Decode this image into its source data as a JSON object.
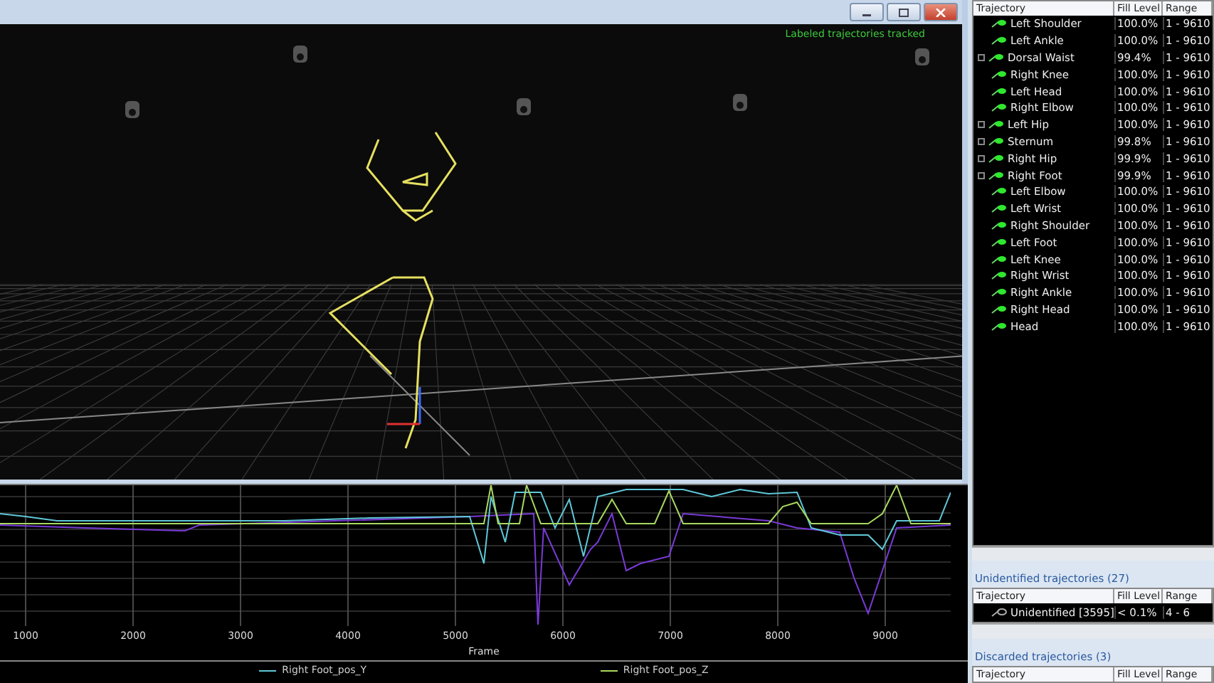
{
  "viewport": {
    "status": "Labeled trajectories tracked"
  },
  "window_buttons": [
    {
      "kind": "minimize"
    },
    {
      "kind": "maximize"
    },
    {
      "kind": "close"
    }
  ],
  "graph": {
    "x_tick_labels": [
      "1000",
      "2000",
      "3000",
      "4000",
      "5000",
      "6000",
      "7000",
      "8000",
      "9000"
    ],
    "xlabel": "Frame",
    "legend": [
      {
        "name": "Right Foot_pos_Y",
        "color": "#5fc8d8"
      },
      {
        "name": "Right Foot_pos_Z",
        "color": "#a8d860"
      }
    ]
  },
  "labeled": {
    "columns": [
      "Trajectory",
      "Fill Level",
      "Range"
    ],
    "rows": [
      {
        "name": "Left Shoulder",
        "fill": "100.0%",
        "range": "1 - 9610",
        "expandable": false
      },
      {
        "name": "Left Ankle",
        "fill": "100.0%",
        "range": "1 - 9610",
        "expandable": false
      },
      {
        "name": "Dorsal Waist",
        "fill": "99.4%",
        "range": "1 - 9610",
        "expandable": true
      },
      {
        "name": "Right Knee",
        "fill": "100.0%",
        "range": "1 - 9610",
        "expandable": false
      },
      {
        "name": "Left Head",
        "fill": "100.0%",
        "range": "1 - 9610",
        "expandable": false
      },
      {
        "name": "Right Elbow",
        "fill": "100.0%",
        "range": "1 - 9610",
        "expandable": false
      },
      {
        "name": "Left Hip",
        "fill": "100.0%",
        "range": "1 - 9610",
        "expandable": true
      },
      {
        "name": "Sternum",
        "fill": "99.8%",
        "range": "1 - 9610",
        "expandable": true
      },
      {
        "name": "Right Hip",
        "fill": "99.9%",
        "range": "1 - 9610",
        "expandable": true
      },
      {
        "name": "Right Foot",
        "fill": "99.9%",
        "range": "1 - 9610",
        "expandable": true
      },
      {
        "name": "Left Elbow",
        "fill": "100.0%",
        "range": "1 - 9610",
        "expandable": false
      },
      {
        "name": "Left Wrist",
        "fill": "100.0%",
        "range": "1 - 9610",
        "expandable": false
      },
      {
        "name": "Right Shoulder",
        "fill": "100.0%",
        "range": "1 - 9610",
        "expandable": false
      },
      {
        "name": "Left Foot",
        "fill": "100.0%",
        "range": "1 - 9610",
        "expandable": false
      },
      {
        "name": "Left Knee",
        "fill": "100.0%",
        "range": "1 - 9610",
        "expandable": false
      },
      {
        "name": "Right Wrist",
        "fill": "100.0%",
        "range": "1 - 9610",
        "expandable": false
      },
      {
        "name": "Right Ankle",
        "fill": "100.0%",
        "range": "1 - 9610",
        "expandable": false
      },
      {
        "name": "Right Head",
        "fill": "100.0%",
        "range": "1 - 9610",
        "expandable": false
      },
      {
        "name": "Head",
        "fill": "100.0%",
        "range": "1 - 9610",
        "expandable": false
      }
    ]
  },
  "unidentified": {
    "title": "Unidentified trajectories (27)",
    "columns": [
      "Trajectory",
      "Fill Level",
      "Range"
    ],
    "rows": [
      {
        "name": "Unidentified [3595]",
        "fill": "< 0.1%",
        "range": "4 - 6"
      }
    ]
  },
  "discarded": {
    "title": "Discarded trajectories (3)",
    "columns": [
      "Trajectory",
      "Fill Level",
      "Range"
    ]
  }
}
